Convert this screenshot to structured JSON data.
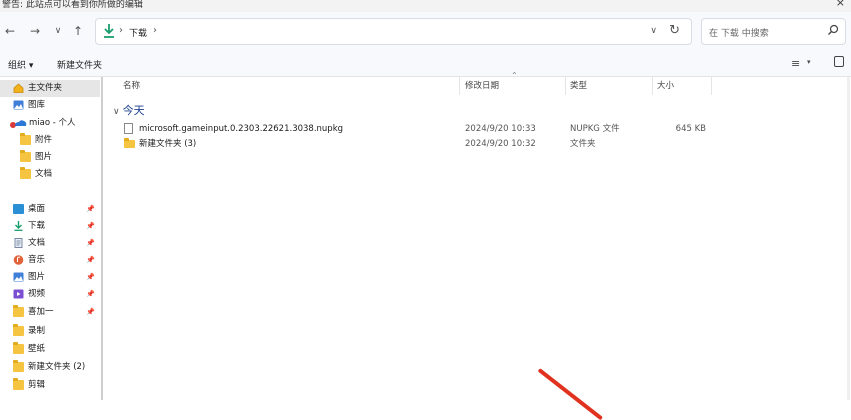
{
  "window": {
    "title": "警告: 此站点可以看到你所做的编辑",
    "close_glyph": "×"
  },
  "nav": {
    "back": "←",
    "forward": "→",
    "recent": "∨",
    "up": "↑"
  },
  "address": {
    "separator": "›",
    "crumb": "下载",
    "dropdown": "∨",
    "refresh": "↻"
  },
  "search": {
    "placeholder": "在 下载 中搜索"
  },
  "toolbar": {
    "organize": "组织 ▾",
    "new_folder": "新建文件夹",
    "view": "≡",
    "view_dropdown": "▾"
  },
  "sidebar": {
    "home": "主文件夹",
    "gallery": "图库",
    "onedrive": "miao - 个人",
    "onedrive_children": [
      "附件",
      "图片",
      "文档"
    ],
    "quick_access": [
      {
        "label": "桌面",
        "pin": "📌"
      },
      {
        "label": "下载",
        "pin": "📌"
      },
      {
        "label": "文档",
        "pin": "📌"
      },
      {
        "label": "音乐",
        "pin": "📌"
      },
      {
        "label": "图片",
        "pin": "📌"
      },
      {
        "label": "视频",
        "pin": "📌"
      },
      {
        "label": "喜加一",
        "pin": "📌"
      }
    ],
    "folders": [
      "录制",
      "壁纸",
      "新建文件夹 (2)",
      "剪辑"
    ]
  },
  "columns": {
    "name": "名称",
    "date": "修改日期",
    "type": "类型",
    "size": "大小"
  },
  "group": {
    "label": "今天",
    "chevron": "∨"
  },
  "files": [
    {
      "name": "microsoft.gameinput.0.2303.22621.3038.nupkg",
      "date": "2024/9/20 10:33",
      "type": "NUPKG 文件",
      "size": "645 KB"
    },
    {
      "name": "新建文件夹 (3)",
      "date": "2024/9/20 10:32",
      "type": "文件夹",
      "size": ""
    }
  ]
}
